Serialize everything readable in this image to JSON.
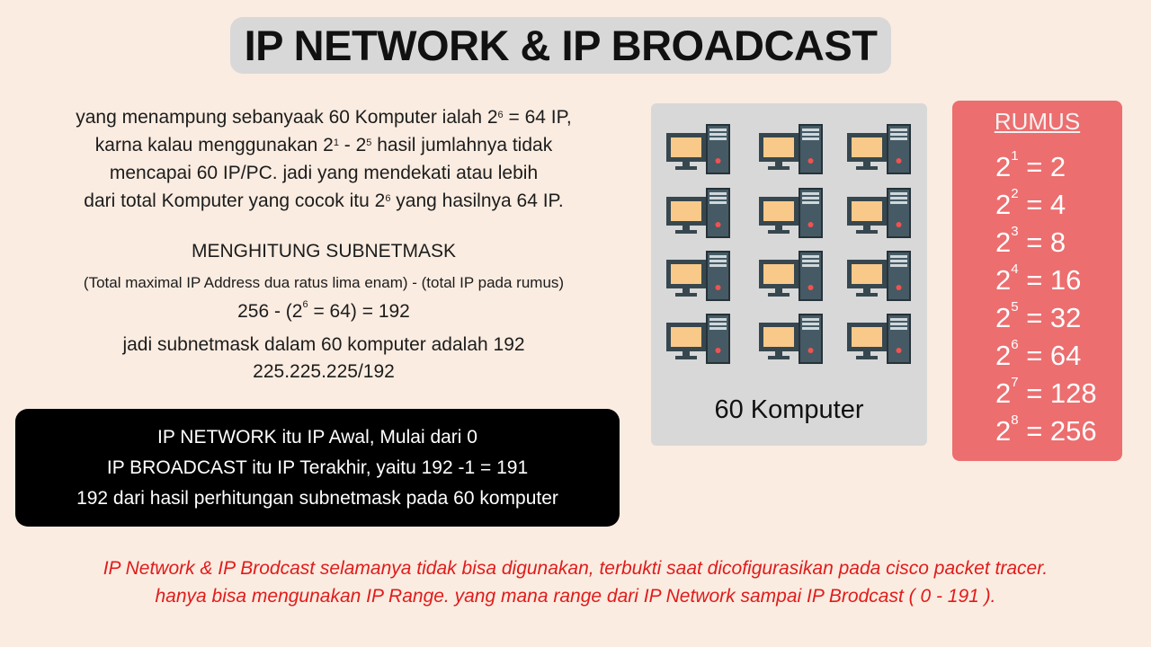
{
  "title": "IP NETWORK & IP BROADCAST",
  "intro": {
    "l1a": "yang menampung sebanyaak 60 Komputer ialah  2",
    "l1sup": "6",
    "l1b": " = 64 IP,",
    "l2a": "karna kalau  menggunakan 2",
    "l2sup1": "1",
    "l2mid": " - 2",
    "l2sup2": "5",
    "l2b": " hasil jumlahnya tidak",
    "l3": "mencapai 60 IP/PC.  jadi yang mendekati atau lebih",
    "l4a": "dari total Komputer yang cocok itu 2",
    "l4sup": "6",
    "l4b": "  yang hasilnya 64 IP."
  },
  "subnet": {
    "title": "MENGHITUNG SUBNETMASK",
    "formula": "(Total maximal IP Address dua ratus lima enam) - (total IP pada rumus)",
    "result_a": "256 - (2",
    "result_sup": "6",
    "result_b": " = 64) = 192",
    "conclusion": "jadi subnetmask dalam 60 komputer adalah 192",
    "mask": "225.225.225/192"
  },
  "info": {
    "l1": "IP NETWORK itu IP Awal, Mulai dari 0",
    "l2": "IP BROADCAST itu IP Terakhir, yaitu 192 -1 = 191",
    "l3": "192 dari hasil perhitungan subnetmask pada 60 komputer"
  },
  "computers": {
    "caption": "60 Komputer",
    "icon": "desktop-computer-icon",
    "count_shown": 12
  },
  "rumus": {
    "title": "RUMUS",
    "rows": [
      {
        "base": "2",
        "exp": "1",
        "val": " = 2"
      },
      {
        "base": "2",
        "exp": "2",
        "val": " = 4"
      },
      {
        "base": "2",
        "exp": "3",
        "val": " = 8"
      },
      {
        "base": "2",
        "exp": "4",
        "val": " = 16"
      },
      {
        "base": "2",
        "exp": "5",
        "val": " = 32"
      },
      {
        "base": "2",
        "exp": "6",
        "val": " = 64"
      },
      {
        "base": "2",
        "exp": "7",
        "val": " = 128"
      },
      {
        "base": "2",
        "exp": "8",
        "val": " = 256"
      }
    ]
  },
  "note": {
    "l1": "IP Network & IP Brodcast selamanya tidak bisa digunakan, terbukti saat dicofigurasikan pada cisco packet tracer.",
    "l2": "hanya bisa mengunakan IP Range. yang mana range dari IP Network sampai IP Brodcast ( 0 - 191 )."
  },
  "colors": {
    "background": "#faece1",
    "title_box": "#d8d8d8",
    "rumus_box": "#ec6e6f",
    "note_text": "#e11b1b",
    "monitor_screen": "#f9c98a"
  }
}
